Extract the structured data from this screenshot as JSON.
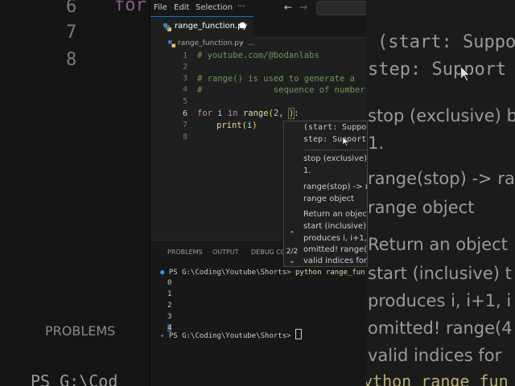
{
  "bg_left": {
    "line_numbers": [
      "6",
      "7",
      "8"
    ],
    "keyword_fragment": "for",
    "panel_label": "PROBLEMS",
    "terminal_fragment": "PS G:\\Cod"
  },
  "bg_right": {
    "lines": [
      "(start: Suppo",
      "step: Support",
      "stop (exclusive) b",
      "1.",
      "range(stop) -> ra",
      "range object",
      "Return an object",
      "start (inclusive) t",
      "produces i, i+1, i",
      "omitted! range(4",
      "valid indices for",
      "ython range_fun"
    ]
  },
  "menubar": {
    "items": [
      "File",
      "Edit",
      "Selection"
    ],
    "more": "···",
    "back": "←",
    "forward": "→"
  },
  "tab": {
    "filename": "range_function.py",
    "modified_dot": "●"
  },
  "breadcrumb": {
    "file": "range_function.py",
    "sep": "›",
    "more": "..."
  },
  "editor": {
    "line_numbers": [
      "1",
      "2",
      "3",
      "4",
      "5",
      "6",
      "7",
      "8"
    ],
    "line1": "# youtube.com/@bodanlabs",
    "line3": "# range() is used to generate a",
    "line4": "#              sequence of numbers",
    "line6_for": "for",
    "line6_i": "i",
    "line6_in": "in",
    "line6_range": "range",
    "line6_open": "(",
    "line6_num": "2",
    "line6_comma": ", ",
    "line6_close": ")",
    "line6_colon": ":",
    "line7_print": "print",
    "line7_open": "(",
    "line7_i": "i",
    "line7_close": ")"
  },
  "popup": {
    "sig1": "(start: Suppo",
    "sig2": "step: Support",
    "doc1": "stop (exclusive) b",
    "doc2": "1.",
    "doc3": "range(stop) -> ra",
    "doc4": "range object",
    "doc5": "Return an object",
    "doc6": "start (inclusive) t",
    "doc7": "produces i, i+1, i",
    "doc8": "omitted! range(4",
    "doc9": "valid indices for",
    "pager": "2/2"
  },
  "panel": {
    "tabs": [
      "PROBLEMS",
      "OUTPUT",
      "DEBUG CON"
    ],
    "prompt1": "PS G:\\Coding\\Youtube\\Shorts>",
    "command": "python range_fun",
    "outputs": [
      "0",
      "1",
      "2",
      "3",
      "4"
    ],
    "prompt2": "PS G:\\Coding\\Youtube\\Shorts>"
  }
}
